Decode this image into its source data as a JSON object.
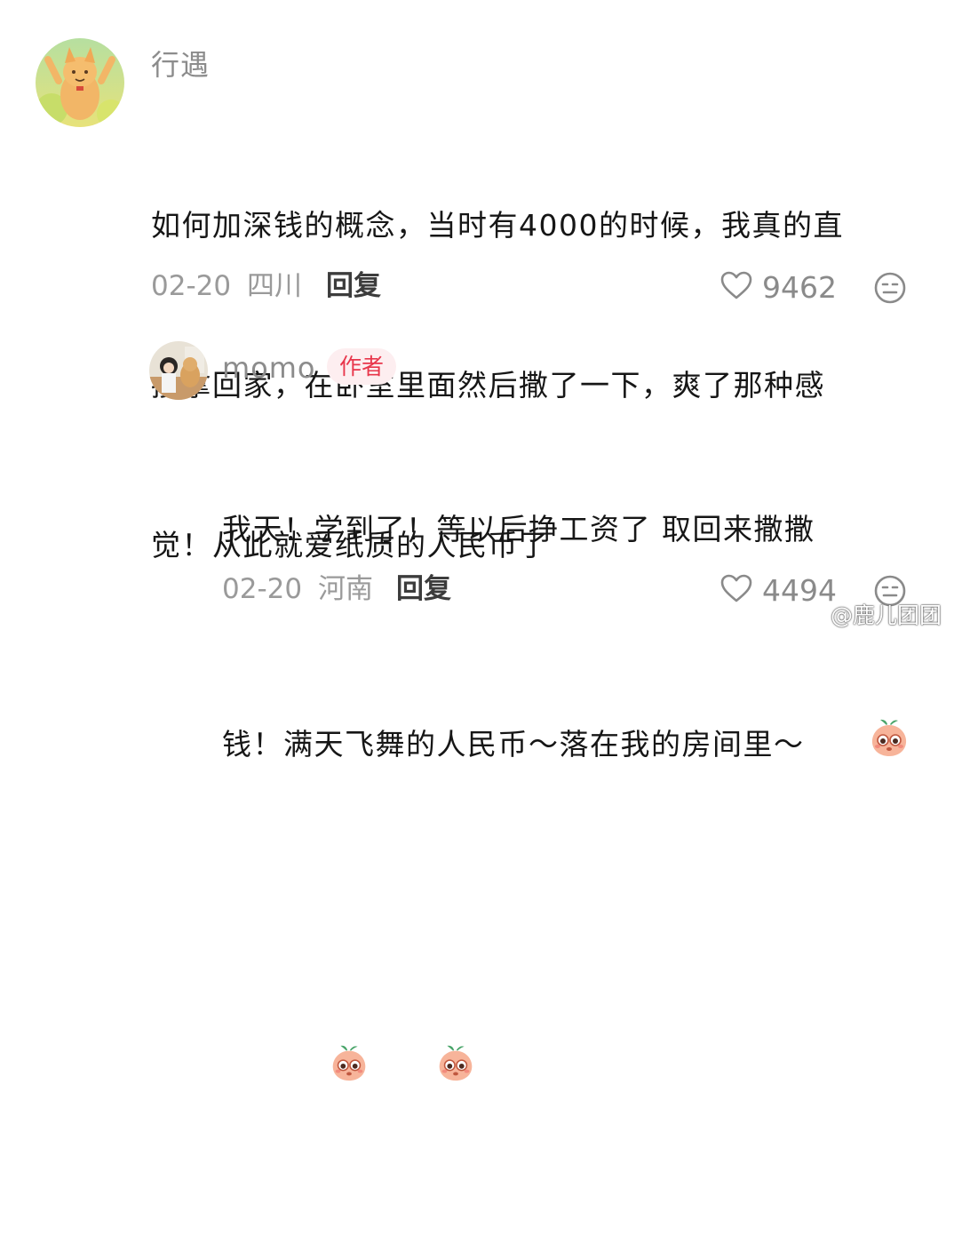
{
  "comment": {
    "username": "行遇",
    "text_line1": "如何加深钱的概念，当时有4000的时候，我真的直",
    "text_line2": "接拿回家，在卧室里面然后撒了一下，爽了那种感",
    "text_line3": "觉！从此就爱纸质的人民币了",
    "date": "02-20",
    "location": "四川",
    "reply_label": "回复",
    "likes": "9462"
  },
  "reply": {
    "username": "momo",
    "author_badge": "作者",
    "text_line1": "我天！学到了！等以后挣工资了 取回来撒撒",
    "text_line2": "钱！满天飞舞的人民币～落在我的房间里～",
    "date": "02-20",
    "location": "河南",
    "reply_label": "回复",
    "likes": "4494"
  },
  "watermark": "@鹿儿团团",
  "icons": {
    "like": "heart-outline-icon",
    "dislike": "neutral-face-icon",
    "emoji": "peach-face-emoji"
  },
  "colors": {
    "badge_text": "#e8364b",
    "badge_bg": "#fdeef0",
    "meta": "#9a9a9a",
    "text": "#161616"
  }
}
